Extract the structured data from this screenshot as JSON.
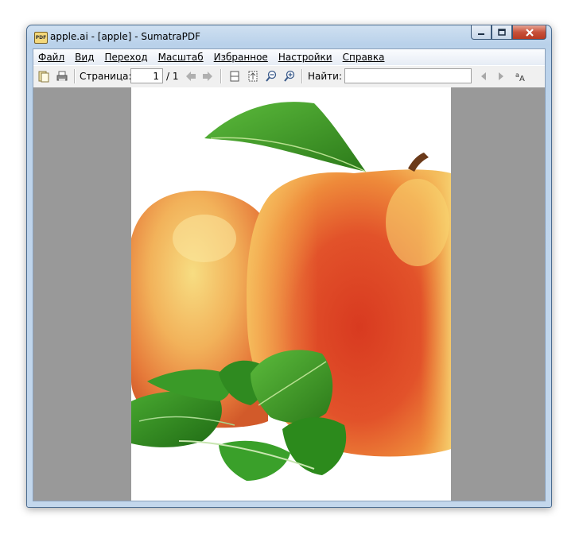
{
  "window": {
    "title": "apple.ai - [apple] - SumatraPDF",
    "app_icon_text": "PDF"
  },
  "menu": [
    "Файл",
    "Вид",
    "Переход",
    "Масштаб",
    "Избранное",
    "Настройки",
    "Справка"
  ],
  "toolbar": {
    "page_label": "Страница:",
    "page_value": "1",
    "page_total": "/ 1",
    "find_label": "Найти:",
    "find_value": ""
  },
  "colors": {
    "viewport_bg": "#999999",
    "title_bar": "#b9d1ea",
    "close_button": "#c7513a"
  }
}
